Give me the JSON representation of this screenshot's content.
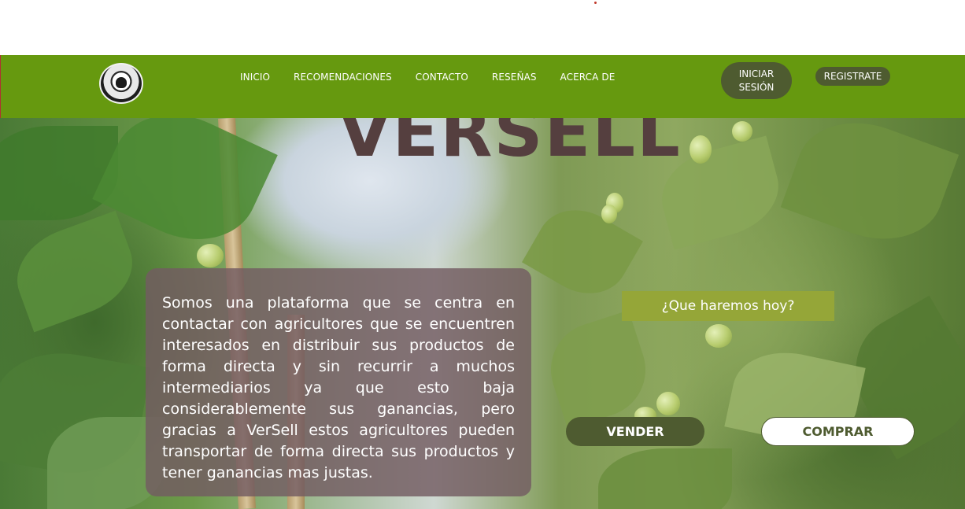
{
  "brand": {
    "name": "VERSELL"
  },
  "nav": {
    "links": [
      "INICIO",
      "RECOMENDACIONES",
      "CONTACTO",
      "RESEÑAS",
      "ACERCA DE"
    ],
    "login_line1": "INICIAR",
    "login_line2": "SESIÓN",
    "register": "REGISTRATE"
  },
  "hero": {
    "description": "Somos una plataforma que se centra en contactar con agricultores que se encuentren interesados en distribuir sus productos de forma directa y sin recurrir a muchos intermediarios ya que esto baja considerablemente sus ganancias, pero gracias a VerSell estos agricultores pueden transportar de forma directa sus productos y tener ganancias mas justas.",
    "question": "¿Que haremos hoy?",
    "sell": "VENDER",
    "buy": "COMPRAR"
  },
  "colors": {
    "navbar": "#66990f",
    "button_dark": "#4e5b30",
    "question_bg": "#95a638",
    "title": "#553f3f",
    "card": "#735c62"
  },
  "icons": {
    "logo": "tomato-seal-logo"
  }
}
